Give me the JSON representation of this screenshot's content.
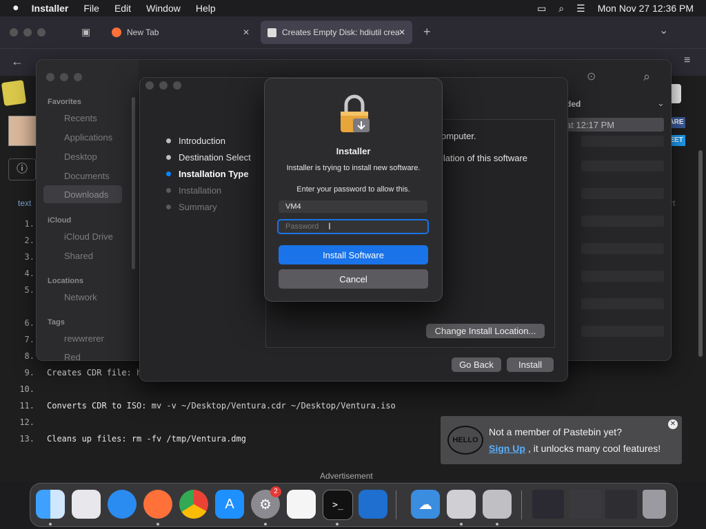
{
  "menubar": {
    "apple": "",
    "app_name": "Installer",
    "menus": [
      "File",
      "Edit",
      "Window",
      "Help"
    ],
    "datetime": "Mon Nov 27  12:36 PM"
  },
  "browser": {
    "tabs": [
      {
        "label": "New Tab",
        "close": "✕"
      },
      {
        "label": "Creates Empty Disk: hdiutil crea",
        "close": "✕"
      }
    ],
    "new_tab": "+",
    "tab_list": "⌄"
  },
  "webpage": {
    "side_text": "text",
    "lines": [
      {
        "n": "1.",
        "text": ""
      },
      {
        "n": "2.",
        "text": ""
      },
      {
        "n": "3.",
        "text": ""
      },
      {
        "n": "4.",
        "text": ""
      },
      {
        "n": "5.",
        "text": ""
      },
      {
        "n": "6.",
        "text": ""
      },
      {
        "n": "7.",
        "text": ""
      },
      {
        "n": "8.",
        "text": ""
      },
      {
        "n": "9.",
        "text": "Creates CDR file: h"
      },
      {
        "n": "10.",
        "text": ""
      },
      {
        "n": "11.",
        "text": "Converts CDR to ISO: mv -v ~/Desktop/Ventura.cdr ~/Desktop/Ventura.iso"
      },
      {
        "n": "12.",
        "text": ""
      },
      {
        "n": "13.",
        "text": "Cleans up files: rm -fv /tmp/Ventura.dmg"
      }
    ],
    "advertisement": "Advertisement",
    "right_badge_1": "ARE",
    "right_badge_2": "EET",
    "right_text": "rt"
  },
  "finder": {
    "sidebar": {
      "favorites_header": "Favorites",
      "favorites": [
        "Recents",
        "Applications",
        "Desktop",
        "Documents",
        "Downloads"
      ],
      "icloud_header": "iCloud",
      "icloud": [
        "iCloud Drive",
        "Shared"
      ],
      "locations_header": "Locations",
      "locations": [
        "Network"
      ],
      "tags_header": "Tags",
      "tags": [
        "rewwrerer",
        "Red"
      ]
    },
    "column_header": "ded",
    "first_row": "at 12:17 PM"
  },
  "installer": {
    "steps": [
      {
        "label": "Introduction",
        "state": "done"
      },
      {
        "label": "Destination Select",
        "state": "done"
      },
      {
        "label": "Installation Type",
        "state": "current"
      },
      {
        "label": "Installation",
        "state": "pending"
      },
      {
        "label": "Summary",
        "state": "pending"
      }
    ],
    "body_line1": "omputer.",
    "body_line2": "llation of this software",
    "change_location": "Change Install Location...",
    "go_back": "Go Back",
    "install": "Install"
  },
  "auth": {
    "title": "Installer",
    "message": "Installer is trying to install new software.",
    "prompt": "Enter your password to allow this.",
    "username": "VM4",
    "password_placeholder": "Password",
    "install_button": "Install Software",
    "cancel_button": "Cancel"
  },
  "popup": {
    "hello": "HELLO",
    "line1": "Not a member of Pastebin yet?",
    "signup": "Sign Up",
    "line2_rest": ", it unlocks many cool features!"
  },
  "dock": {
    "settings_badge": "2"
  },
  "colors": {
    "accent": "#0a84ff",
    "auth_button": "#1a73e8",
    "signup_link": "#5ab0ff"
  }
}
